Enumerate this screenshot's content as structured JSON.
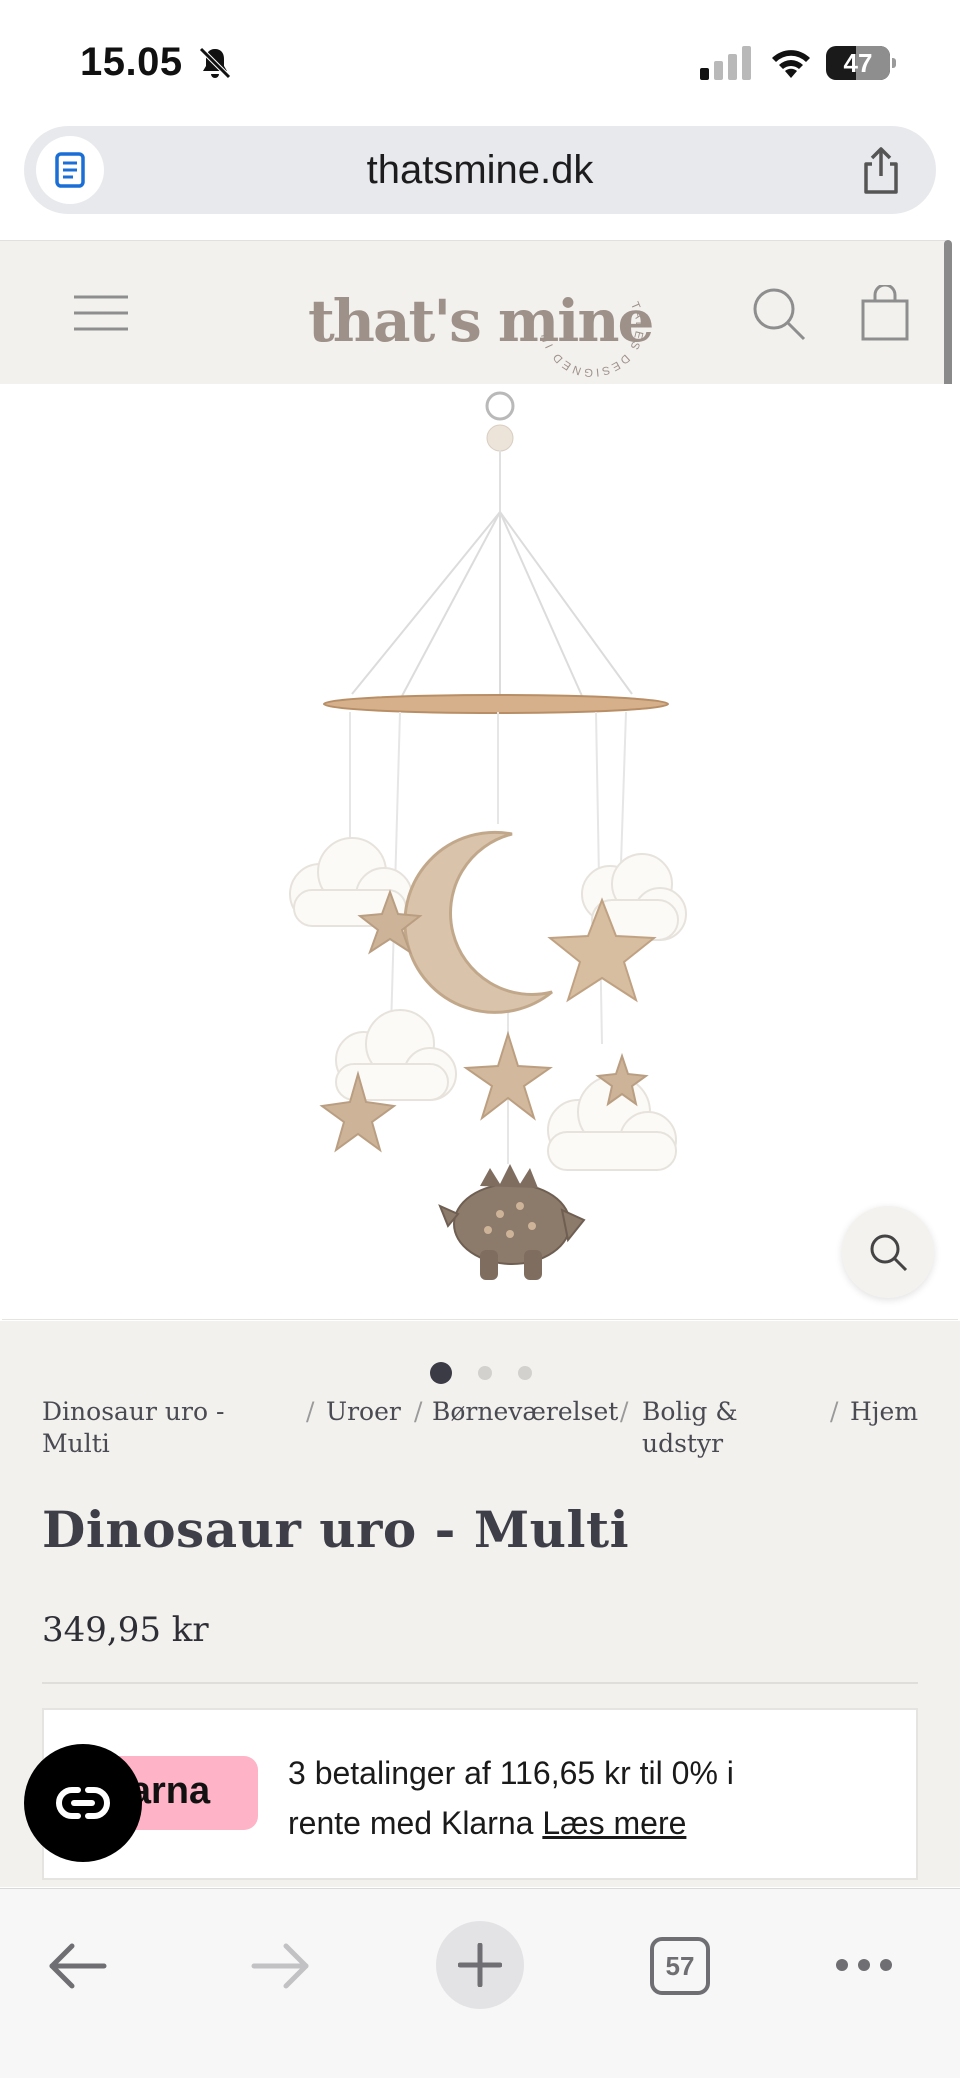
{
  "status_bar": {
    "time": "15.05",
    "battery_percent": "47",
    "battery_level": 0.47
  },
  "browser": {
    "url": "thatsmine.dk",
    "tab_count": "57"
  },
  "header": {
    "logo_text": "that's mine",
    "logo_ring_text": "TALES DESIGNED IN DENMARK"
  },
  "gallery": {
    "image_count": 3,
    "active_index": 0
  },
  "breadcrumb": [
    {
      "label": "Dinosaur uro -",
      "label2": "Multi"
    },
    {
      "label": "Uroer"
    },
    {
      "label": "Børneværelset"
    },
    {
      "label": "Bolig &",
      "label2": "udstyr"
    },
    {
      "label": "Hjem"
    }
  ],
  "product": {
    "title": "Dinosaur uro - Multi",
    "price": "349,95 kr"
  },
  "klarna": {
    "badge_text": "Klarna",
    "badge_visible_text": "arna",
    "message_line1": "3 betalinger af 116,65 kr til 0% i",
    "message_line2": "rente med Klarna ",
    "link_text": "Læs mere",
    "badge_color": "#ffb3c7"
  },
  "icons": {
    "menu": "hamburger-menu-icon",
    "search": "search-icon",
    "bag": "shopping-bag-icon",
    "zoom": "zoom-icon",
    "chat": "chat-icon"
  }
}
